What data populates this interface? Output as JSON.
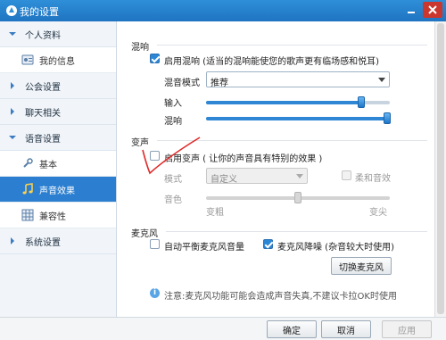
{
  "window": {
    "title": "我的设置"
  },
  "sidebar": {
    "cat_personal": "个人资料",
    "item_myinfo": "我的信息",
    "cat_guild": "公会设置",
    "cat_chat": "聊天相关",
    "cat_voice": "语音设置",
    "item_basic": "基本",
    "item_sound_effects": "声音效果",
    "item_compat": "兼容性",
    "cat_system": "系统设置"
  },
  "reverb": {
    "section_title": "混响",
    "enable_label": "启用混响 (适当的混响能使您的歌声更有临场感和悦耳)",
    "enable_checked": true,
    "mode_label": "混音模式",
    "mode_value": "推荐",
    "input_label": "输入",
    "input_level": 0.86,
    "reverb_label": "混响",
    "reverb_level": 1.0
  },
  "voice_change": {
    "section_title": "变声",
    "enable_label": "启用变声 ( 让你的声音具有特别的效果 )",
    "enable_checked": false,
    "mode_label": "模式",
    "mode_value": "自定义",
    "soft_label": "柔和音效",
    "tone_label": "音色",
    "tone_level": 0.5,
    "tone_left": "变粗",
    "tone_right": "变尖"
  },
  "mic": {
    "section_title": "麦克风",
    "auto_gain_label": "自动平衡麦克风音量",
    "auto_gain_checked": false,
    "noise_label": "麦克风降噪 (杂音较大时使用)",
    "noise_checked": true,
    "switch_button": "切换麦克风",
    "note": "注意:麦克风功能可能会造成声音失真,不建议卡拉OK时使用"
  },
  "footer": {
    "ok": "确定",
    "cancel": "取消",
    "apply": "应用"
  }
}
